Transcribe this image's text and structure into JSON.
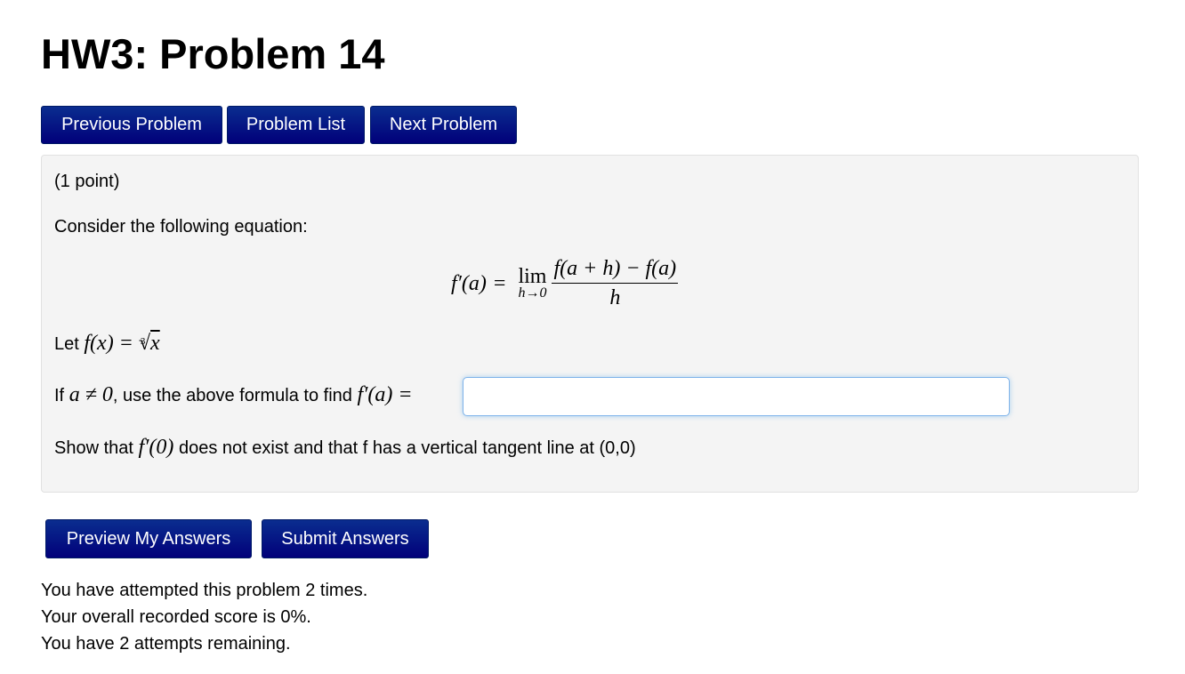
{
  "page": {
    "title": "HW3: Problem 14"
  },
  "nav": {
    "previous_label": "Previous Problem",
    "list_label": "Problem List",
    "next_label": "Next Problem"
  },
  "problem": {
    "points": "(1 point)",
    "intro": "Consider the following equation:",
    "formula": {
      "lhs": "f′(a)",
      "equals": "=",
      "lim": "lim",
      "lim_sub": "h→0",
      "numerator": "f(a + h) − f(a)",
      "denominator": "h"
    },
    "let_prefix": "Let",
    "let_math": "f(x) = ",
    "root_index": "3",
    "root_radicand": "x",
    "question_prefix": "If",
    "question_condition": "a ≠ 0",
    "question_middle": ", use the above formula to find",
    "question_math": "f′(a) =",
    "answer": {
      "value": "",
      "placeholder": ""
    },
    "show_prefix": "Show that",
    "show_math": "f′(0)",
    "show_suffix": "does not exist and that f has a vertical tangent line at (0,0)"
  },
  "actions": {
    "preview_label": "Preview My Answers",
    "submit_label": "Submit Answers"
  },
  "status": {
    "attempts": "You have attempted this problem 2 times.",
    "score": "Your overall recorded score is 0%.",
    "remaining": "You have 2 attempts remaining."
  },
  "colors": {
    "button_bg": "#01007a",
    "panel_bg": "#f4f4f4",
    "input_focus": "#7fb3ea"
  }
}
